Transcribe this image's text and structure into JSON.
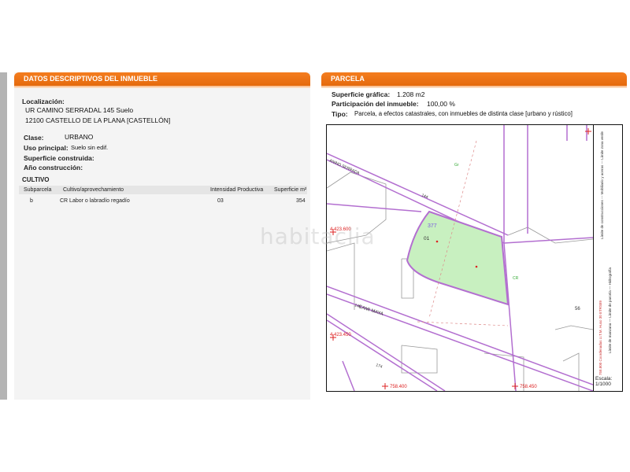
{
  "left": {
    "header": "DATOS DESCRIPTIVOS DEL INMUEBLE",
    "localizacion_label": "Localización:",
    "address_line1": "UR CAMINO SERRADAL 145 Suelo",
    "address_line2": "12100 CASTELLO DE LA PLANA [CASTELLÓN]",
    "clase_label": "Clase:",
    "clase_value": "URBANO",
    "uso_label": "Uso principal:",
    "uso_value": "Suelo sin edif.",
    "superficie_label": "Superficie construida:",
    "anio_label": "Año construcción:",
    "cultivo_title": "CULTIVO",
    "columns": [
      "Subparcela",
      "Cultivo/aprovechamiento",
      "Intensidad Productiva",
      "Superficie m²"
    ],
    "rows": [
      {
        "subparcela": "b",
        "cultivo": "CR Labor o labradío regadío",
        "intensidad": "03",
        "superficie": "354"
      }
    ]
  },
  "right": {
    "header": "PARCELA",
    "sup_grafica_label": "Superficie gráfica:",
    "sup_grafica_value": "1.208 m2",
    "participacion_label": "Participación del inmueble:",
    "participacion_value": "100,00 %",
    "tipo_label": "Tipo:",
    "tipo_value": "Parcela, a efectos catastrales, con inmuebles de distinta clase [urbano y rústico]",
    "map": {
      "parcel_number": "01",
      "parcel_ref": "377",
      "street1": "ANINO SERRADA",
      "street2": "CAMI MAYA",
      "num_144": "144",
      "num_145": "145",
      "num_174": "174",
      "num_56": "56",
      "coord_1": "4.423.600",
      "coord_2": "4.423.450",
      "coord_3": "758.400",
      "coord_4": "758.450",
      "label_a": "Gr",
      "label_b": "CR"
    },
    "legend": {
      "items_line1": "Límite de manzana   —   Límite de parcela   —   Hidrografía",
      "items_line2": "Límite de construcciones   ---   Mobiliario y aceras   ---   Límite zona verde",
      "coords_note": "758.800 Coordenadas U.T.M. Huso 30 ETRS89"
    },
    "escala_label": "Escala:",
    "escala_value": "1/1000"
  },
  "watermark": "habitaclia",
  "colors": {
    "header_orange": "#f47d1f",
    "parcel_fill": "#c8f0c0",
    "boundary_purple": "#b36fd0",
    "coord_red": "#d22"
  }
}
